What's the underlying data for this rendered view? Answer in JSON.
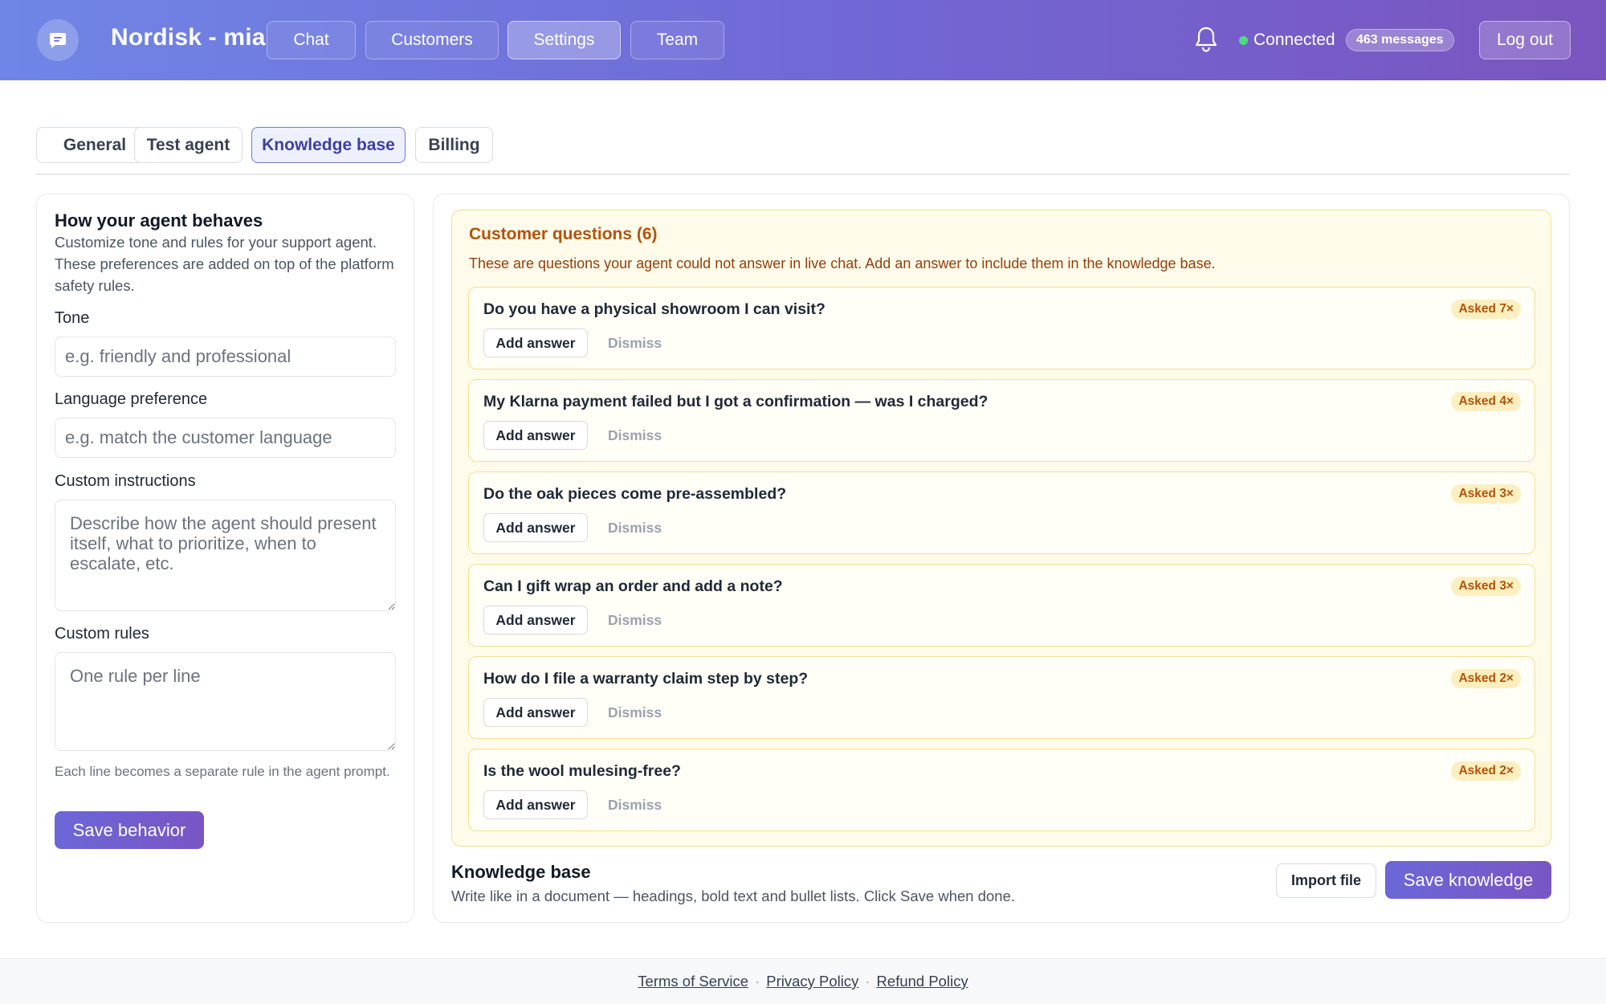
{
  "app": {
    "title": "Nordisk - mia",
    "logo_icon": "chat-bubble-icon"
  },
  "nav": {
    "items": [
      {
        "label": "Chat",
        "active": false
      },
      {
        "label": "Customers",
        "active": false
      },
      {
        "label": "Settings",
        "active": true
      },
      {
        "label": "Team",
        "active": false
      }
    ]
  },
  "header": {
    "bell_icon": "bell-icon",
    "status": "Connected",
    "status_color": "#4ade80",
    "message_count": "463 messages",
    "logout_label": "Log out"
  },
  "tabs": [
    {
      "label": "General",
      "active": false
    },
    {
      "label": "Test agent",
      "active": false
    },
    {
      "label": "Knowledge base",
      "active": true
    },
    {
      "label": "Billing",
      "active": false
    }
  ],
  "behavior": {
    "title": "How your agent behaves",
    "description": "Customize tone and rules for your support agent. These preferences are added on top of the platform safety rules.",
    "tone_label": "Tone",
    "tone_placeholder": "e.g. friendly and professional",
    "tone_value": "",
    "language_label": "Language preference",
    "language_placeholder": "e.g. match the customer language",
    "language_value": "",
    "instructions_label": "Custom instructions",
    "instructions_placeholder": "Describe how the agent should present itself, what to prioritize, when to escalate, etc.",
    "rules_label": "Custom rules",
    "rules_placeholder": "One rule per line",
    "rules_hint": "Each line becomes a separate rule in the agent prompt.",
    "save_label": "Save behavior"
  },
  "questions": {
    "title": "Customer questions (6)",
    "subtitle": "These are questions your agent could not answer in live chat. Add an answer to include them in the knowledge base.",
    "add_answer_label": "Add answer",
    "dismiss_label": "Dismiss",
    "items": [
      {
        "text": "Do you have a physical showroom I can visit?",
        "asked": "Asked 7×"
      },
      {
        "text": "My Klarna payment failed but I got a confirmation — was I charged?",
        "asked": "Asked 4×"
      },
      {
        "text": "Do the oak pieces come pre-assembled?",
        "asked": "Asked 3×"
      },
      {
        "text": "Can I gift wrap an order and add a note?",
        "asked": "Asked 3×"
      },
      {
        "text": "How do I file a warranty claim step by step?",
        "asked": "Asked 2×"
      },
      {
        "text": "Is the wool mulesing-free?",
        "asked": "Asked 2×"
      }
    ]
  },
  "knowledge": {
    "title": "Knowledge base",
    "description": "Write like in a document — headings, bold text and bullet lists. Click Save when done.",
    "import_label": "Import file",
    "save_label": "Save knowledge"
  },
  "footer": {
    "links": [
      "Terms of Service",
      "Privacy Policy",
      "Refund Policy"
    ],
    "separator": "·"
  }
}
